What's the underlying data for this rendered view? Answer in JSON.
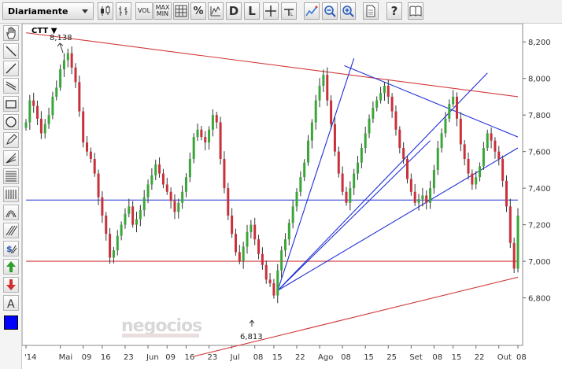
{
  "toolbar": {
    "period": "Diariamente",
    "vol_label": "VOL",
    "maxmin_label_1": "MAX",
    "maxmin_label_2": "MIN",
    "percent_label": "%",
    "d_label": "D",
    "l_label": "L",
    "help_label": "?"
  },
  "symbol": "CTT",
  "watermark": "negocios",
  "annotations": {
    "high": "8,138",
    "low": "6,813"
  },
  "colors": {
    "up": "#3aa63a",
    "down": "#c8303a",
    "trend_red": "#d23a3a",
    "trend_blue": "#1f2fd6",
    "selection": "#0000ff"
  },
  "chart_data": {
    "type": "candlestick",
    "ylim": [
      6540,
      8300
    ],
    "y_ticks": [
      "8,200",
      "8,000",
      "7,800",
      "7,600",
      "7,400",
      "7,200",
      "7,000",
      "6,800"
    ],
    "y_tick_values": [
      8200,
      8000,
      7800,
      7600,
      7400,
      7200,
      7000,
      6800
    ],
    "x_labels": [
      "'14",
      "Mai",
      "09",
      "16",
      "23",
      "Jun",
      "09",
      "16",
      "23",
      "Jul",
      "08",
      "15",
      "22",
      "Ago",
      "08",
      "15",
      "25",
      "Set",
      "08",
      "15",
      "22",
      "Out",
      "08"
    ],
    "x_label_index": [
      0,
      9,
      15,
      20,
      26,
      32,
      37,
      42,
      48,
      54,
      60,
      65,
      71,
      77,
      83,
      89,
      95,
      101,
      107,
      112,
      118,
      124,
      129
    ],
    "close": [
      7760,
      7880,
      7850,
      7780,
      7700,
      7750,
      7800,
      7900,
      7950,
      8050,
      8100,
      8138,
      8060,
      7980,
      7820,
      7650,
      7600,
      7560,
      7480,
      7350,
      7250,
      7150,
      7020,
      7060,
      7140,
      7200,
      7260,
      7300,
      7200,
      7230,
      7280,
      7350,
      7420,
      7470,
      7530,
      7480,
      7420,
      7380,
      7330,
      7270,
      7320,
      7380,
      7460,
      7560,
      7680,
      7720,
      7680,
      7650,
      7720,
      7800,
      7760,
      7560,
      7400,
      7250,
      7150,
      7050,
      7000,
      7080,
      7160,
      7200,
      7120,
      7040,
      6980,
      6900,
      6880,
      6813,
      6950,
      7060,
      7120,
      7210,
      7300,
      7380,
      7460,
      7540,
      7660,
      7760,
      7880,
      7960,
      8020,
      7880,
      7750,
      7600,
      7480,
      7380,
      7320,
      7400,
      7480,
      7540,
      7620,
      7700,
      7780,
      7840,
      7880,
      7920,
      7960,
      7900,
      7820,
      7720,
      7620,
      7560,
      7450,
      7380,
      7320,
      7340,
      7360,
      7320,
      7400,
      7500,
      7620,
      7700,
      7780,
      7860,
      7900,
      7780,
      7640,
      7560,
      7480,
      7420,
      7460,
      7520,
      7620,
      7700,
      7660,
      7600,
      7560,
      7440,
      7300,
      7100,
      6960,
      7250
    ]
  }
}
